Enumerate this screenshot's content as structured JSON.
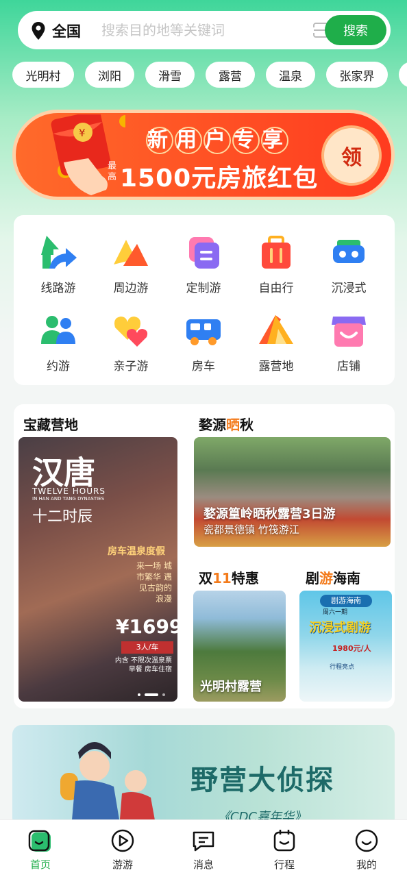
{
  "search": {
    "location": "全国",
    "placeholder": "搜索目的地等关键词",
    "button": "搜索"
  },
  "chips": [
    "光明村",
    "浏阳",
    "滑雪",
    "露营",
    "温泉",
    "张家界"
  ],
  "banner": {
    "subtitle": [
      "新",
      "用",
      "户",
      "专",
      "享"
    ],
    "prefix": "最高",
    "main": "1500元房旅红包",
    "claim": "领",
    "envelope_mark": "¥"
  },
  "categories": [
    {
      "label": "线路游",
      "icon": "route-icon"
    },
    {
      "label": "周边游",
      "icon": "mountain-icon"
    },
    {
      "label": "定制游",
      "icon": "custom-icon"
    },
    {
      "label": "自由行",
      "icon": "luggage-icon"
    },
    {
      "label": "沉浸式",
      "icon": "vr-icon"
    },
    {
      "label": "约游",
      "icon": "people-icon"
    },
    {
      "label": "亲子游",
      "icon": "family-heart-icon"
    },
    {
      "label": "房车",
      "icon": "rv-icon"
    },
    {
      "label": "露营地",
      "icon": "tent-icon"
    },
    {
      "label": "店铺",
      "icon": "shop-icon"
    }
  ],
  "sections": {
    "camp": {
      "title": "宝藏营地",
      "card": {
        "title": "汉唐",
        "en": "TWELVE HOURS",
        "en_sub": "IN HAN AND TANG DYNASTIES",
        "cn": "十二时辰",
        "tag": "房车温泉度假",
        "slogan": "来一场 城市繁华 遇见古韵的 浪漫",
        "price": "¥1699",
        "unit": "3人/车",
        "includes": "内含 不限次温泉票 早餐 房车住宿"
      }
    },
    "wuyuan": {
      "title_a": "婺源",
      "title_hl": "晒",
      "title_b": "秋",
      "line1": "婺源篁岭晒秋露营3日游",
      "line2": "瓷都景德镇 竹筏游江"
    },
    "double11": {
      "title_a": "双",
      "title_hl": "11",
      "title_b": "特惠",
      "caption": "光明村露营"
    },
    "hainan": {
      "title_a": "剧",
      "title_hl": "游",
      "title_b": "海南",
      "pill": "剧游海南",
      "sub": "周六一期",
      "headline": "沉浸式剧游",
      "price": "1980元/人",
      "note": "行程亮点"
    }
  },
  "bottom_banner": {
    "title": "野营大侦探",
    "subtitle": "《CDC嘉年华》"
  },
  "tabs": [
    {
      "label": "首页",
      "icon": "home-icon",
      "active": true
    },
    {
      "label": "游游",
      "icon": "play-icon",
      "active": false
    },
    {
      "label": "消息",
      "icon": "message-icon",
      "active": false
    },
    {
      "label": "行程",
      "icon": "itinerary-icon",
      "active": false
    },
    {
      "label": "我的",
      "icon": "profile-icon",
      "active": false
    }
  ],
  "colors": {
    "accent": "#1fae4a",
    "banner": "#ff4a22",
    "highlight": "#f37b1c"
  }
}
